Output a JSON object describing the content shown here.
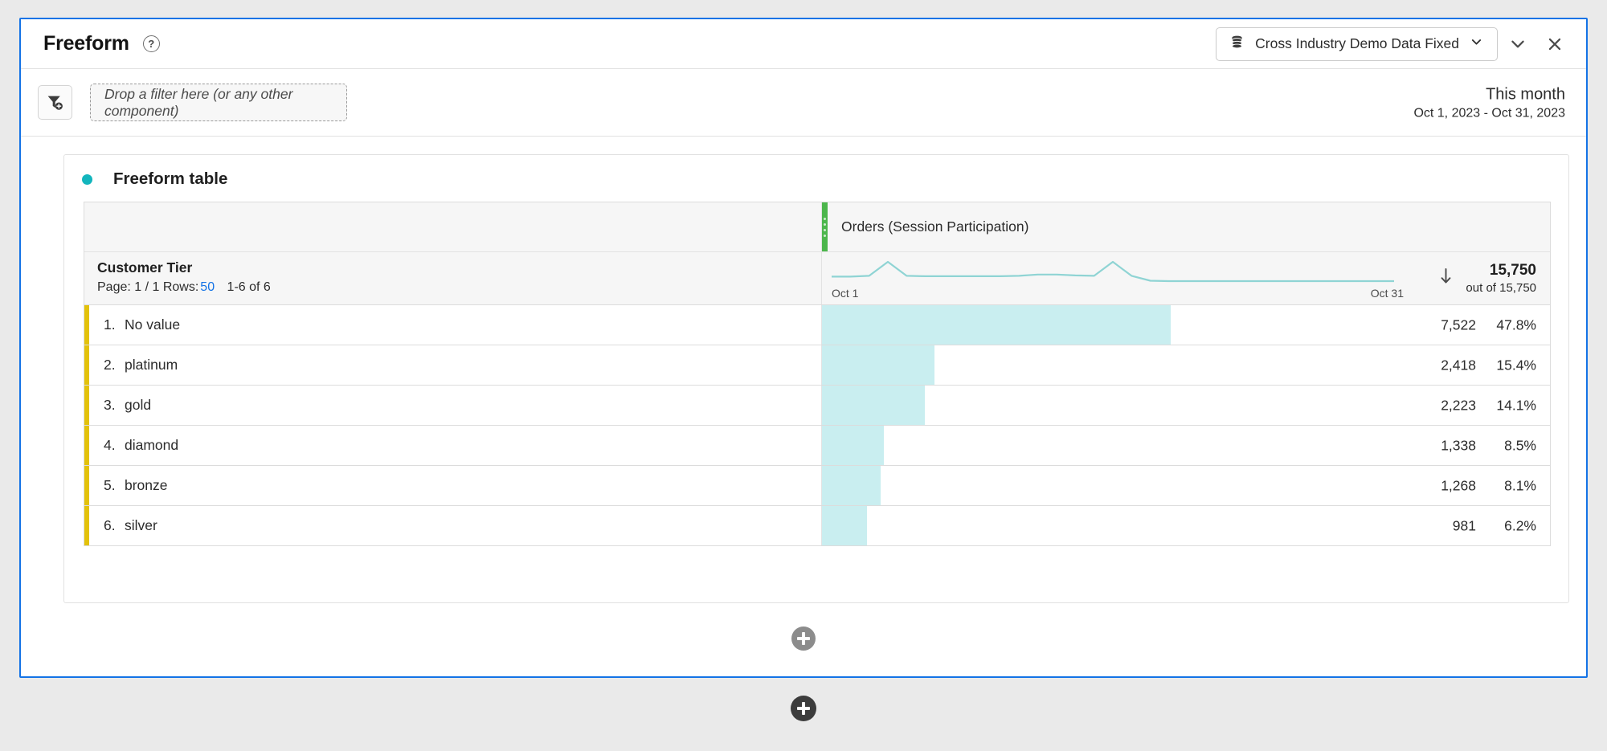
{
  "window": {
    "title": "Freeform",
    "help_icon": "question-mark-icon",
    "datasource": {
      "icon": "database-icon",
      "label": "Cross Industry Demo Data Fixed",
      "chevron": "chevron-down-icon"
    },
    "collapse_icon": "chevron-down-icon",
    "close_icon": "close-icon"
  },
  "filterbar": {
    "add_filter_icon": "filter-add-icon",
    "dropzone_placeholder": "Drop a filter here (or any other component)",
    "date_preset": "This month",
    "date_range": "Oct 1, 2023 - Oct 31, 2023"
  },
  "card": {
    "status_dot": "teal-status-dot",
    "title": "Freeform table"
  },
  "table": {
    "metric_header": "Orders (Session Participation)",
    "dimension_name": "Customer Tier",
    "page_label": "Page: 1 / 1",
    "rows_label": "Rows:",
    "rows_value": "50",
    "range_label": "1-6 of 6",
    "sparkline_start_label": "Oct 1",
    "sparkline_end_label": "Oct 31",
    "sort_icon": "sort-descending-arrow-icon",
    "total_value": "15,750",
    "total_sub": "out of 15,750",
    "rows": [
      {
        "index": "1.",
        "label": "No value",
        "value": "7,522",
        "percent": "47.8%",
        "pct_num": 47.8
      },
      {
        "index": "2.",
        "label": "platinum",
        "value": "2,418",
        "percent": "15.4%",
        "pct_num": 15.4
      },
      {
        "index": "3.",
        "label": "gold",
        "value": "2,223",
        "percent": "14.1%",
        "pct_num": 14.1
      },
      {
        "index": "4.",
        "label": "diamond",
        "value": "1,338",
        "percent": "8.5%",
        "pct_num": 8.5
      },
      {
        "index": "5.",
        "label": "bronze",
        "value": "1,268",
        "percent": "8.1%",
        "pct_num": 8.1
      },
      {
        "index": "6.",
        "label": "silver",
        "value": "981",
        "percent": "6.2%",
        "pct_num": 6.2
      }
    ]
  },
  "add_buttons": {
    "inner": "add-panel-button",
    "outer": "add-panel-button"
  },
  "colors": {
    "accent_blue": "#1473e6",
    "metric_green": "#4cb64c",
    "dimension_yellow": "#e3c20a",
    "bar_fill": "#c9eef0",
    "status_teal": "#12b5bd",
    "sparkline": "#8fd4d4"
  },
  "chart_data": {
    "type": "bar",
    "title": "Orders (Session Participation)",
    "categories": [
      "No value",
      "platinum",
      "gold",
      "diamond",
      "bronze",
      "silver"
    ],
    "values": [
      7522,
      2418,
      2223,
      1338,
      1268,
      981
    ],
    "percents": [
      47.8,
      15.4,
      14.1,
      8.5,
      8.1,
      6.2
    ],
    "total": 15750,
    "xlabel": "",
    "ylabel": "Customer Tier",
    "grid": false,
    "legend": false,
    "sparkline": {
      "type": "line",
      "xlabel_start": "Oct 1",
      "xlabel_end": "Oct 31",
      "values": [
        520,
        520,
        530,
        700,
        530,
        525,
        525,
        525,
        525,
        525,
        530,
        545,
        545,
        535,
        530,
        700,
        530,
        470,
        465,
        465,
        465,
        465,
        465,
        465,
        465,
        465,
        465,
        465,
        465,
        465,
        465
      ]
    }
  }
}
